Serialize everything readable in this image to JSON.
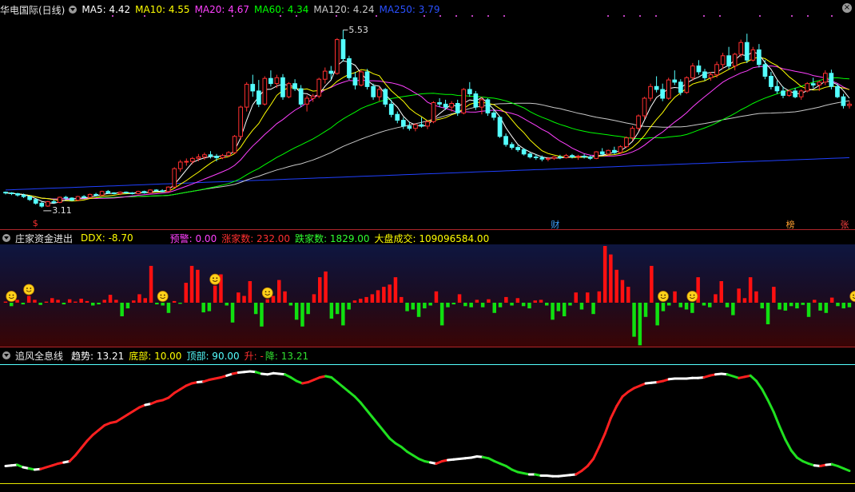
{
  "main_header": {
    "title": "华电国际(日线)",
    "ma5_label": "MA5: 4.42",
    "ma10_label": "MA10: 4.55",
    "ma20_label": "MA20: 4.67",
    "ma60_label": "MA60: 4.34",
    "ma120_label": "MA120: 4.24",
    "ma250_label": "MA250: 3.79"
  },
  "price_annotations": {
    "high": "5.53",
    "low": "3.11"
  },
  "event_markers": [
    {
      "label": "$",
      "color": "#ff3030"
    },
    {
      "label": "财",
      "color": "#3aa0ff"
    },
    {
      "label": "榜",
      "color": "#ffa030"
    },
    {
      "label": "张",
      "color": "#ff4040"
    }
  ],
  "ddx_header": {
    "title": "庄家资金进出",
    "ddx": "DDX: -8.70",
    "warn": "预警: 0.00",
    "up_count": "涨家数: 232.00",
    "down_count": "跌家数: 1829.00",
    "volume": "大盘成交: 109096584.00"
  },
  "trend_header": {
    "title": "追风全息线",
    "trend": "趋势: 13.21",
    "bottom": "底部: 10.00",
    "top": "顶部: 90.00",
    "updown_prefix": "升: -",
    "updown_suffix": "降: 13.21"
  },
  "colors": {
    "up": "#ff3030",
    "down": "#54ffff",
    "ma5": "#ffffff",
    "ma10": "#ffff00",
    "ma20": "#ff40ff",
    "ma60": "#00ff00",
    "ma120": "#c8c8c8",
    "ma250": "#2040ff",
    "ddx_pos": "#ff1010",
    "ddx_neg": "#10e010",
    "trend_up": "#ff2020",
    "trend_down": "#20e020"
  },
  "chart_data": [
    {
      "type": "candlestick",
      "title": "华电国际(日线)",
      "ylim": [
        3.0,
        5.7
      ],
      "ohlc": [
        [
          3.32,
          3.33,
          3.29,
          3.31
        ],
        [
          3.31,
          3.32,
          3.28,
          3.3
        ],
        [
          3.3,
          3.31,
          3.26,
          3.28
        ],
        [
          3.28,
          3.3,
          3.24,
          3.26
        ],
        [
          3.26,
          3.27,
          3.2,
          3.22
        ],
        [
          3.22,
          3.23,
          3.15,
          3.17
        ],
        [
          3.17,
          3.19,
          3.11,
          3.13
        ],
        [
          3.13,
          3.2,
          3.12,
          3.19
        ],
        [
          3.19,
          3.22,
          3.16,
          3.18
        ],
        [
          3.18,
          3.26,
          3.17,
          3.25
        ],
        [
          3.25,
          3.27,
          3.22,
          3.24
        ],
        [
          3.24,
          3.25,
          3.2,
          3.21
        ],
        [
          3.21,
          3.27,
          3.2,
          3.26
        ],
        [
          3.26,
          3.28,
          3.24,
          3.25
        ],
        [
          3.25,
          3.3,
          3.24,
          3.29
        ],
        [
          3.29,
          3.31,
          3.26,
          3.28
        ],
        [
          3.28,
          3.34,
          3.27,
          3.33
        ],
        [
          3.33,
          3.35,
          3.3,
          3.31
        ],
        [
          3.31,
          3.32,
          3.29,
          3.3
        ],
        [
          3.3,
          3.33,
          3.28,
          3.32
        ],
        [
          3.32,
          3.33,
          3.3,
          3.31
        ],
        [
          3.31,
          3.32,
          3.29,
          3.3
        ],
        [
          3.3,
          3.34,
          3.29,
          3.33
        ],
        [
          3.33,
          3.34,
          3.3,
          3.31
        ],
        [
          3.31,
          3.36,
          3.3,
          3.35
        ],
        [
          3.35,
          3.36,
          3.33,
          3.34
        ],
        [
          3.34,
          3.36,
          3.32,
          3.33
        ],
        [
          3.33,
          3.4,
          3.32,
          3.39
        ],
        [
          3.39,
          3.66,
          3.38,
          3.64
        ],
        [
          3.64,
          3.76,
          3.6,
          3.73
        ],
        [
          3.73,
          3.78,
          3.68,
          3.74
        ],
        [
          3.74,
          3.8,
          3.7,
          3.78
        ],
        [
          3.78,
          3.84,
          3.74,
          3.8
        ],
        [
          3.8,
          3.86,
          3.76,
          3.83
        ],
        [
          3.83,
          3.88,
          3.78,
          3.81
        ],
        [
          3.81,
          3.84,
          3.74,
          3.79
        ],
        [
          3.79,
          3.84,
          3.77,
          3.82
        ],
        [
          3.82,
          3.88,
          3.8,
          3.86
        ],
        [
          3.86,
          4.1,
          3.84,
          4.08
        ],
        [
          4.08,
          4.5,
          4.04,
          4.48
        ],
        [
          4.48,
          4.82,
          4.42,
          4.79
        ],
        [
          4.79,
          4.92,
          4.62,
          4.7
        ],
        [
          4.7,
          4.85,
          4.48,
          4.52
        ],
        [
          4.52,
          4.9,
          4.5,
          4.87
        ],
        [
          4.87,
          4.98,
          4.76,
          4.8
        ],
        [
          4.8,
          4.92,
          4.74,
          4.88
        ],
        [
          4.88,
          4.93,
          4.58,
          4.62
        ],
        [
          4.62,
          4.82,
          4.6,
          4.8
        ],
        [
          4.8,
          4.86,
          4.7,
          4.73
        ],
        [
          4.73,
          4.78,
          4.48,
          4.52
        ],
        [
          4.52,
          4.64,
          4.42,
          4.6
        ],
        [
          4.6,
          4.66,
          4.55,
          4.63
        ],
        [
          4.63,
          4.88,
          4.6,
          4.86
        ],
        [
          4.86,
          5.02,
          4.8,
          4.97
        ],
        [
          4.97,
          5.04,
          4.86,
          4.94
        ],
        [
          4.94,
          5.42,
          4.92,
          5.4
        ],
        [
          5.4,
          5.53,
          5.1,
          5.14
        ],
        [
          5.14,
          5.18,
          4.85,
          4.88
        ],
        [
          4.88,
          4.96,
          4.72,
          4.78
        ],
        [
          4.78,
          4.98,
          4.76,
          4.96
        ],
        [
          4.96,
          5.0,
          4.72,
          4.76
        ],
        [
          4.76,
          4.8,
          4.58,
          4.62
        ],
        [
          4.62,
          4.76,
          4.56,
          4.72
        ],
        [
          4.72,
          4.74,
          4.48,
          4.52
        ],
        [
          4.52,
          4.58,
          4.34,
          4.38
        ],
        [
          4.38,
          4.42,
          4.26,
          4.3
        ],
        [
          4.3,
          4.34,
          4.18,
          4.22
        ],
        [
          4.22,
          4.28,
          4.16,
          4.19
        ],
        [
          4.19,
          4.26,
          4.15,
          4.24
        ],
        [
          4.24,
          4.34,
          4.2,
          4.22
        ],
        [
          4.22,
          4.3,
          4.18,
          4.28
        ],
        [
          4.28,
          4.56,
          4.26,
          4.54
        ],
        [
          4.54,
          4.6,
          4.48,
          4.52
        ],
        [
          4.52,
          4.58,
          4.44,
          4.48
        ],
        [
          4.48,
          4.56,
          4.42,
          4.53
        ],
        [
          4.53,
          4.58,
          4.36,
          4.4
        ],
        [
          4.4,
          4.74,
          4.38,
          4.72
        ],
        [
          4.72,
          4.82,
          4.62,
          4.66
        ],
        [
          4.66,
          4.7,
          4.44,
          4.48
        ],
        [
          4.48,
          4.62,
          4.38,
          4.58
        ],
        [
          4.58,
          4.6,
          4.36,
          4.4
        ],
        [
          4.4,
          4.44,
          4.3,
          4.34
        ],
        [
          4.34,
          4.36,
          4.06,
          4.08
        ],
        [
          4.08,
          4.12,
          3.94,
          3.97
        ],
        [
          3.97,
          4.0,
          3.9,
          3.93
        ],
        [
          3.93,
          3.96,
          3.87,
          3.9
        ],
        [
          3.9,
          3.92,
          3.82,
          3.84
        ],
        [
          3.84,
          3.86,
          3.78,
          3.8
        ],
        [
          3.8,
          3.84,
          3.76,
          3.79
        ],
        [
          3.79,
          3.82,
          3.74,
          3.77
        ],
        [
          3.77,
          3.8,
          3.74,
          3.78
        ],
        [
          3.78,
          3.81,
          3.76,
          3.8
        ],
        [
          3.8,
          3.83,
          3.77,
          3.79
        ],
        [
          3.79,
          3.84,
          3.78,
          3.82
        ],
        [
          3.82,
          3.84,
          3.78,
          3.8
        ],
        [
          3.8,
          3.83,
          3.76,
          3.81
        ],
        [
          3.81,
          3.84,
          3.78,
          3.8
        ],
        [
          3.8,
          3.82,
          3.76,
          3.78
        ],
        [
          3.78,
          3.88,
          3.77,
          3.87
        ],
        [
          3.87,
          3.92,
          3.82,
          3.84
        ],
        [
          3.84,
          3.9,
          3.82,
          3.89
        ],
        [
          3.89,
          3.94,
          3.84,
          3.86
        ],
        [
          3.86,
          3.96,
          3.84,
          3.94
        ],
        [
          3.94,
          4.08,
          3.92,
          4.06
        ],
        [
          4.06,
          4.22,
          4.02,
          4.19
        ],
        [
          4.19,
          4.38,
          4.16,
          4.36
        ],
        [
          4.36,
          4.62,
          4.32,
          4.6
        ],
        [
          4.6,
          4.8,
          4.56,
          4.76
        ],
        [
          4.76,
          4.9,
          4.68,
          4.72
        ],
        [
          4.72,
          4.8,
          4.56,
          4.6
        ],
        [
          4.6,
          4.88,
          4.58,
          4.85
        ],
        [
          4.85,
          4.98,
          4.78,
          4.82
        ],
        [
          4.82,
          4.86,
          4.64,
          4.68
        ],
        [
          4.68,
          4.9,
          4.66,
          4.88
        ],
        [
          4.88,
          5.08,
          4.84,
          5.04
        ],
        [
          5.04,
          5.12,
          4.92,
          4.96
        ],
        [
          4.96,
          5.0,
          4.84,
          4.88
        ],
        [
          4.88,
          4.96,
          4.84,
          4.92
        ],
        [
          4.92,
          5.1,
          4.88,
          5.06
        ],
        [
          5.06,
          5.22,
          5.0,
          5.18
        ],
        [
          5.18,
          5.3,
          5.0,
          5.04
        ],
        [
          5.04,
          5.22,
          4.98,
          5.2
        ],
        [
          5.2,
          5.4,
          5.16,
          5.36
        ],
        [
          5.36,
          5.48,
          5.08,
          5.12
        ],
        [
          5.12,
          5.3,
          5.1,
          5.26
        ],
        [
          5.26,
          5.34,
          5.02,
          5.06
        ],
        [
          5.06,
          5.12,
          4.86,
          4.9
        ],
        [
          4.9,
          4.96,
          4.72,
          4.76
        ],
        [
          4.76,
          4.84,
          4.66,
          4.7
        ],
        [
          4.7,
          4.76,
          4.6,
          4.64
        ],
        [
          4.64,
          4.72,
          4.62,
          4.7
        ],
        [
          4.7,
          4.74,
          4.6,
          4.62
        ],
        [
          4.62,
          4.72,
          4.58,
          4.7
        ],
        [
          4.7,
          4.82,
          4.68,
          4.8
        ],
        [
          4.8,
          4.88,
          4.74,
          4.78
        ],
        [
          4.78,
          4.84,
          4.7,
          4.82
        ],
        [
          4.82,
          4.98,
          4.78,
          4.94
        ],
        [
          4.94,
          4.99,
          4.72,
          4.76
        ],
        [
          4.76,
          4.8,
          4.6,
          4.62
        ],
        [
          4.62,
          4.66,
          4.46,
          4.5
        ],
        [
          4.5,
          4.56,
          4.46,
          4.52
        ]
      ]
    },
    {
      "type": "bar",
      "title": "庄家资金进出",
      "ylim": [
        -8,
        10
      ],
      "values": [
        0.2,
        -0.6,
        0.5,
        -0.3,
        1.2,
        0.5,
        -0.4,
        0.2,
        0.8,
        0.5,
        -0.3,
        0.6,
        0.2,
        0.7,
        0.3,
        -0.5,
        -0.3,
        0.5,
        1.4,
        0.5,
        -2.4,
        -1.0,
        0.4,
        1.5,
        0.8,
        6.5,
        -0.3,
        -0.5,
        -1.8,
        0.3,
        -0.2,
        3.5,
        6.5,
        5.8,
        -1.7,
        -1.5,
        3.0,
        5.0,
        -0.5,
        -3.5,
        1.8,
        1.2,
        3.8,
        -2.0,
        -4.2,
        0.6,
        1.2,
        4.0,
        2.0,
        -0.5,
        -3.0,
        -4.2,
        -2.0,
        1.5,
        4.5,
        5.5,
        -2.8,
        -2.0,
        -4.0,
        -1.2,
        0.4,
        0.7,
        1.0,
        1.5,
        2.2,
        2.8,
        3.2,
        4.5,
        1.0,
        -1.5,
        -1.2,
        -2.5,
        -1.0,
        -0.5,
        2.0,
        -4.0,
        -0.8,
        -0.3,
        1.5,
        -0.6,
        -0.8,
        0.5,
        -0.8,
        0.6,
        -1.8,
        -0.8,
        1.0,
        -0.5,
        0.8,
        -0.6,
        -1.0,
        0.4,
        0.5,
        -0.5,
        -3.0,
        -1.5,
        -2.4,
        -0.5,
        1.8,
        -1.2,
        1.8,
        -2.0,
        2.0,
        10.0,
        8.5,
        5.8,
        4.0,
        2.8,
        -6.0,
        -7.5,
        -2.5,
        6.5,
        -4.0,
        -1.5,
        -0.5,
        2.0,
        -0.8,
        -1.2,
        -1.8,
        4.5,
        -0.5,
        -0.8,
        1.5,
        3.8,
        -0.8,
        -2.2,
        2.5,
        0.8,
        4.5,
        2.0,
        -1.0,
        -3.8,
        2.8,
        -1.2,
        -1.4,
        -0.6,
        -1.0,
        -0.4,
        -2.5,
        0.5,
        -1.4,
        -1.8,
        0.9,
        -0.6,
        -1.0,
        -0.8
      ],
      "signals": [
        1,
        4,
        27,
        36,
        45,
        113,
        118,
        146
      ]
    },
    {
      "type": "line",
      "title": "追风全息线",
      "ylim": [
        0,
        100
      ],
      "ref_lines": [
        10,
        90
      ],
      "values": [
        15,
        15.5,
        16,
        14,
        13,
        12,
        12.5,
        14,
        15.5,
        17,
        18,
        19,
        24,
        30,
        36,
        41,
        45,
        49,
        51,
        52,
        55,
        58,
        61,
        64,
        66,
        67,
        69,
        70,
        72,
        76,
        79,
        82,
        84,
        85,
        85.5,
        87,
        88,
        89,
        90.5,
        92,
        93,
        93.5,
        94,
        93.5,
        92,
        91.5,
        92.5,
        92,
        91.5,
        89,
        86,
        84,
        85,
        87,
        89,
        90,
        89,
        85,
        81,
        77,
        73,
        68,
        62,
        56,
        50,
        44,
        38,
        34,
        31,
        27,
        24,
        21,
        19,
        18,
        17,
        19,
        20,
        20.5,
        21,
        21.5,
        22,
        23,
        22.5,
        21.5,
        19,
        17,
        15,
        12,
        10,
        9,
        8,
        8,
        7,
        7,
        6.5,
        6.5,
        7,
        7.5,
        8,
        11,
        15,
        21,
        31,
        42,
        55,
        65,
        73,
        77,
        80,
        82,
        84,
        84.5,
        85,
        86,
        87.5,
        88,
        88,
        88,
        88.5,
        88.5,
        89,
        90.5,
        91.5,
        92,
        91.5,
        90,
        88.5,
        89.5,
        90.5,
        86,
        79,
        70,
        60,
        48,
        37,
        28,
        22,
        19,
        17,
        15.5,
        15,
        16,
        16.5,
        15,
        13,
        11
      ]
    }
  ]
}
